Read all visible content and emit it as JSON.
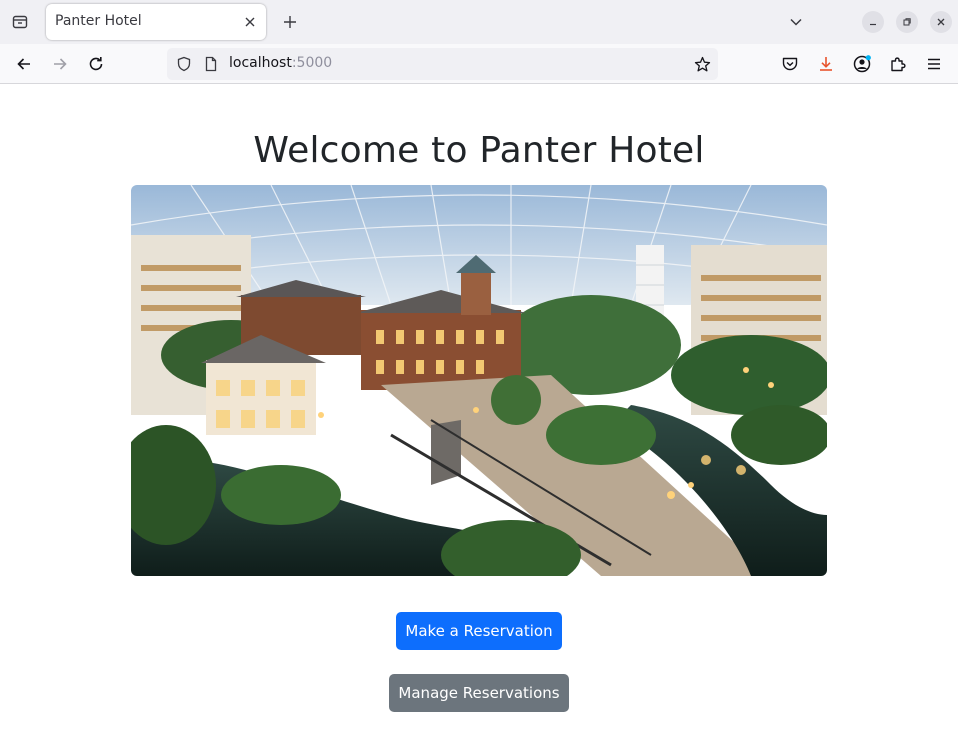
{
  "browser": {
    "tab_title": "Panter Hotel",
    "url_host": "localhost",
    "url_port": ":5000",
    "icons": {
      "tab_list": "tab-list-icon",
      "close": "close-icon",
      "new_tab": "plus-icon",
      "list_all_tabs": "chevron-down-icon",
      "back": "arrow-left-icon",
      "forward": "arrow-right-icon",
      "reload": "reload-icon",
      "shield": "shield-icon",
      "page": "page-icon",
      "bookmark": "star-icon",
      "pocket": "pocket-icon",
      "downloads": "download-icon",
      "account": "account-icon",
      "extensions": "puzzle-icon",
      "menu": "hamburger-icon"
    },
    "colors": {
      "download_accent": "#e8542e",
      "account_badge": "#00b3f4"
    }
  },
  "page": {
    "title": "Welcome to Panter Hotel",
    "hero_image": "hotel-atrium-photo",
    "buttons": {
      "reserve_label": "Make a Reservation",
      "manage_label": "Manage Reservations"
    },
    "colors": {
      "primary": "#0d6efd",
      "secondary": "#6c757d",
      "heading": "#212529"
    }
  }
}
